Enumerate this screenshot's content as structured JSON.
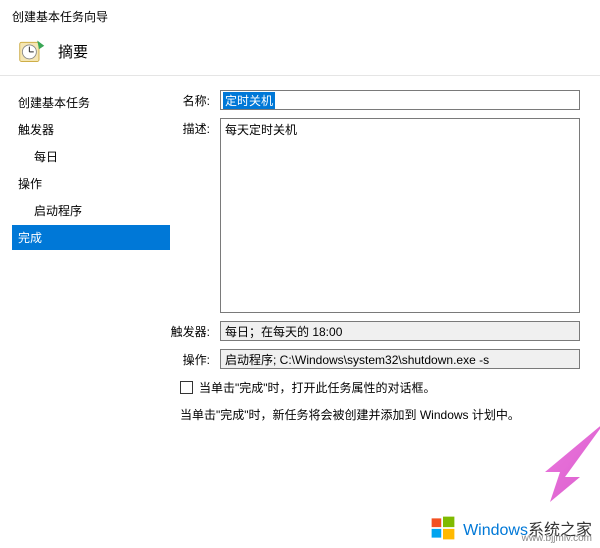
{
  "header": {
    "wizard_title": "创建基本任务向导",
    "summary_label": "摘要"
  },
  "sidebar": {
    "items": [
      {
        "label": "创建基本任务",
        "indent": 0
      },
      {
        "label": "触发器",
        "indent": 0
      },
      {
        "label": "每日",
        "indent": 1
      },
      {
        "label": "操作",
        "indent": 0
      },
      {
        "label": "启动程序",
        "indent": 1
      },
      {
        "label": "完成",
        "indent": 0,
        "active": true
      }
    ]
  },
  "form": {
    "name_label": "名称:",
    "name_value": "定时关机",
    "desc_label": "描述:",
    "desc_value": "每天定时关机",
    "trigger_label": "触发器:",
    "trigger_value": "每日；在每天的 18:00",
    "action_label": "操作:",
    "action_value": "启动程序; C:\\Windows\\system32\\shutdown.exe -s"
  },
  "checkbox_label": "当单击\"完成\"时，打开此任务属性的对话框。",
  "note_text": "当单击\"完成\"时，新任务将会被创建并添加到 Windows 计划中。",
  "watermark": {
    "brand": "Windows",
    "suffix": "系统之家",
    "url": "www.bjjmlv.com"
  }
}
